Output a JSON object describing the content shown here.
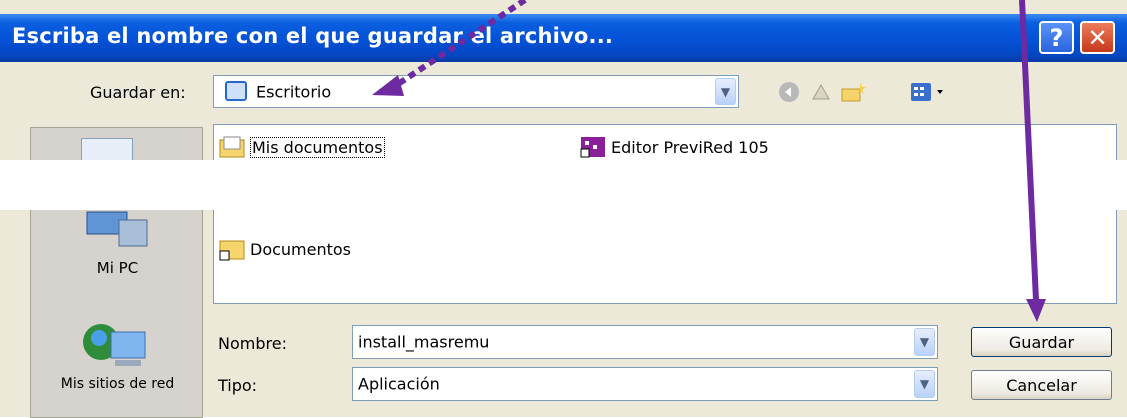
{
  "window": {
    "title": "Escriba el nombre con el que guardar el archivo...",
    "help": "?",
    "close": "✕"
  },
  "location": {
    "label": "Guardar en:",
    "value": "Escritorio"
  },
  "places": [
    {
      "label": "Mi PC"
    },
    {
      "label": "Mis sitios de red"
    }
  ],
  "files": [
    {
      "name": "Mis documentos",
      "icon": "folder-icon"
    },
    {
      "name": "Editor PreviRed 105",
      "icon": "app-shortcut-icon"
    },
    {
      "name": "Documentos",
      "icon": "folder-shortcut-icon"
    }
  ],
  "form": {
    "name_label": "Nombre:",
    "name_value": "install_masremu",
    "type_label": "Tipo:",
    "type_value": "Aplicación"
  },
  "buttons": {
    "save": "Guardar",
    "cancel": "Cancelar"
  },
  "colors": {
    "titlebar": "#0551d6",
    "dialog": "#ece9d8",
    "annotation_arrow": "#6e2aa0"
  }
}
